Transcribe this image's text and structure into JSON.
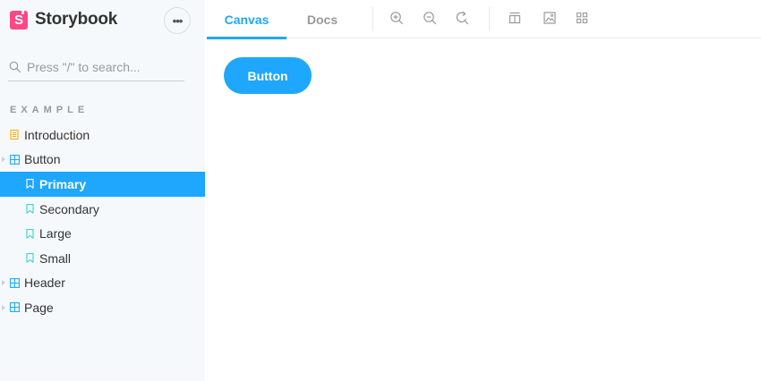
{
  "brand": {
    "logo_letter": "S",
    "name": "Storybook"
  },
  "sidebar": {
    "menu_label": "•••",
    "search": {
      "placeholder": "Press \"/\" to search...",
      "value": ""
    },
    "section_title": "EXAMPLE",
    "items": [
      {
        "label": "Introduction",
        "icon": "document-icon",
        "level": 0
      },
      {
        "label": "Button",
        "icon": "component-icon",
        "level": 0,
        "expanded": true
      },
      {
        "label": "Primary",
        "icon": "bookmark-icon",
        "level": 1,
        "selected": true
      },
      {
        "label": "Secondary",
        "icon": "bookmark-icon",
        "level": 1
      },
      {
        "label": "Large",
        "icon": "bookmark-icon",
        "level": 1
      },
      {
        "label": "Small",
        "icon": "bookmark-icon",
        "level": 1
      },
      {
        "label": "Header",
        "icon": "component-icon",
        "level": 0
      },
      {
        "label": "Page",
        "icon": "component-icon",
        "level": 0
      }
    ]
  },
  "toolbar": {
    "tabs": [
      {
        "label": "Canvas",
        "active": true
      },
      {
        "label": "Docs",
        "active": false
      }
    ],
    "tools": [
      "zoom-in-icon",
      "zoom-out-icon",
      "zoom-reset-icon",
      "grid-background-icon",
      "image-background-icon",
      "outline-grid-icon"
    ]
  },
  "canvas": {
    "button_label": "Button"
  },
  "colors": {
    "accent": "#1ea7fd",
    "brand": "#ff4785",
    "sidebar_bg": "#f6f9fc",
    "doc_icon": "#ffae00",
    "component_icon": "#1ea7fd",
    "story_icon": "#37d5d3"
  }
}
